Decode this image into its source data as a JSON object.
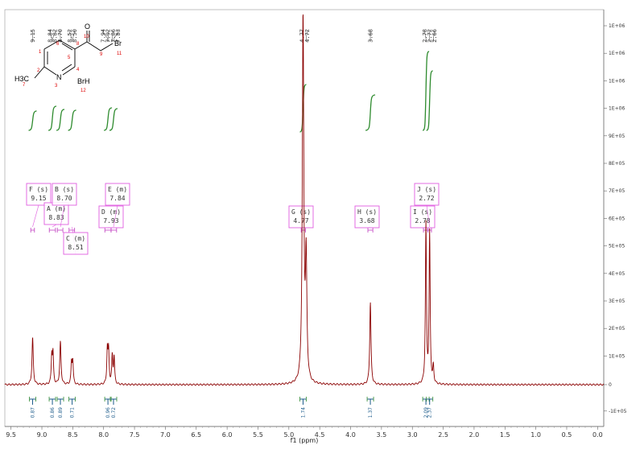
{
  "chart_data": {
    "type": "line",
    "xlabel": "f1 (ppm)",
    "ylabel": "",
    "xlim": [
      9.6,
      -0.1
    ],
    "ylim": [
      -100000.0,
      1300000.0
    ],
    "x_ticks": [
      "9.5",
      "9.0",
      "8.5",
      "8.0",
      "7.5",
      "7.0",
      "6.5",
      "6.0",
      "5.5",
      "5.0",
      "4.5",
      "4.0",
      "3.5",
      "3.0",
      "2.5",
      "2.0",
      "1.5",
      "1.0",
      "0.5",
      "0.0"
    ],
    "y_ticks": [
      "1E+06",
      "1E+06",
      "1E+06",
      "1E+06",
      "9E+05",
      "8E+05",
      "7E+05",
      "6E+05",
      "5E+05",
      "4E+05",
      "3E+05",
      "2E+05",
      "1E+05",
      "0",
      "-1E+05"
    ],
    "y_tick_values": [
      1240000,
      1140000,
      1040000,
      940000,
      840000,
      740000,
      640000,
      540000,
      440000,
      340000,
      240000,
      140000,
      40000,
      -60000,
      -160000
    ],
    "peak_labels": [
      "9.15",
      "8.84",
      "8.82",
      "8.70",
      "8.52",
      "8.50",
      "7.94",
      "7.92",
      "7.86",
      "7.83",
      "4.77",
      "4.72",
      "3.68",
      "2.78",
      "2.72",
      "2.66"
    ],
    "peaks": [
      {
        "x": 9.15,
        "y": 165000,
        "w": 0.012
      },
      {
        "x": 8.84,
        "y": 100000,
        "w": 0.01
      },
      {
        "x": 8.82,
        "y": 105000,
        "w": 0.01
      },
      {
        "x": 8.7,
        "y": 150000,
        "w": 0.012
      },
      {
        "x": 8.52,
        "y": 75000,
        "w": 0.01
      },
      {
        "x": 8.5,
        "y": 80000,
        "w": 0.01
      },
      {
        "x": 7.94,
        "y": 120000,
        "w": 0.01
      },
      {
        "x": 7.92,
        "y": 115000,
        "w": 0.01
      },
      {
        "x": 7.86,
        "y": 100000,
        "w": 0.01
      },
      {
        "x": 7.83,
        "y": 95000,
        "w": 0.01
      },
      {
        "x": 4.77,
        "y": 1300000,
        "w": 0.014
      },
      {
        "x": 4.72,
        "y": 420000,
        "w": 0.014
      },
      {
        "x": 3.68,
        "y": 290000,
        "w": 0.012
      },
      {
        "x": 2.78,
        "y": 560000,
        "w": 0.01
      },
      {
        "x": 2.72,
        "y": 530000,
        "w": 0.01
      },
      {
        "x": 2.66,
        "y": 60000,
        "w": 0.01
      }
    ],
    "multiplets": [
      {
        "letter": "F",
        "type": "s",
        "shift": "9.15",
        "x": 9.15
      },
      {
        "letter": "A",
        "type": "m",
        "shift": "8.83",
        "x": 8.83
      },
      {
        "letter": "B",
        "type": "s",
        "shift": "8.70",
        "x": 8.7
      },
      {
        "letter": "C",
        "type": "m",
        "shift": "8.51",
        "x": 8.51
      },
      {
        "letter": "D",
        "type": "m",
        "shift": "7.93",
        "x": 7.93
      },
      {
        "letter": "E",
        "type": "m",
        "shift": "7.84",
        "x": 7.84
      },
      {
        "letter": "G",
        "type": "s",
        "shift": "4.77",
        "x": 4.77
      },
      {
        "letter": "H",
        "type": "s",
        "shift": "3.68",
        "x": 3.68
      },
      {
        "letter": "I",
        "type": "s",
        "shift": "2.78",
        "x": 2.78
      },
      {
        "letter": "J",
        "type": "s",
        "shift": "2.72",
        "x": 2.72
      }
    ],
    "integrals": [
      {
        "x": 9.15,
        "value": "0.87"
      },
      {
        "x": 8.83,
        "value": "0.86"
      },
      {
        "x": 8.7,
        "value": "0.89"
      },
      {
        "x": 8.51,
        "value": "0.71"
      },
      {
        "x": 7.93,
        "value": "0.96"
      },
      {
        "x": 7.84,
        "value": "0.72"
      },
      {
        "x": 4.77,
        "value": "1.74"
      },
      {
        "x": 3.68,
        "value": "1.37"
      },
      {
        "x": 2.78,
        "value": "2.09"
      },
      {
        "x": 2.72,
        "value": "2.37"
      }
    ]
  },
  "molecule": {
    "br": "Br",
    "o": "O",
    "ch3": "H3C",
    "n": "N",
    "brh": "BrH",
    "atom_numbers": [
      "6",
      "5",
      "1",
      "4",
      "2",
      "3",
      "7",
      "8",
      "9",
      "10",
      "11",
      "12"
    ]
  },
  "colors": {
    "spectrum": "#8b0000",
    "integral": "#2e8b2e",
    "label_box": "#e05ce0",
    "peak_lines": "#555555"
  }
}
